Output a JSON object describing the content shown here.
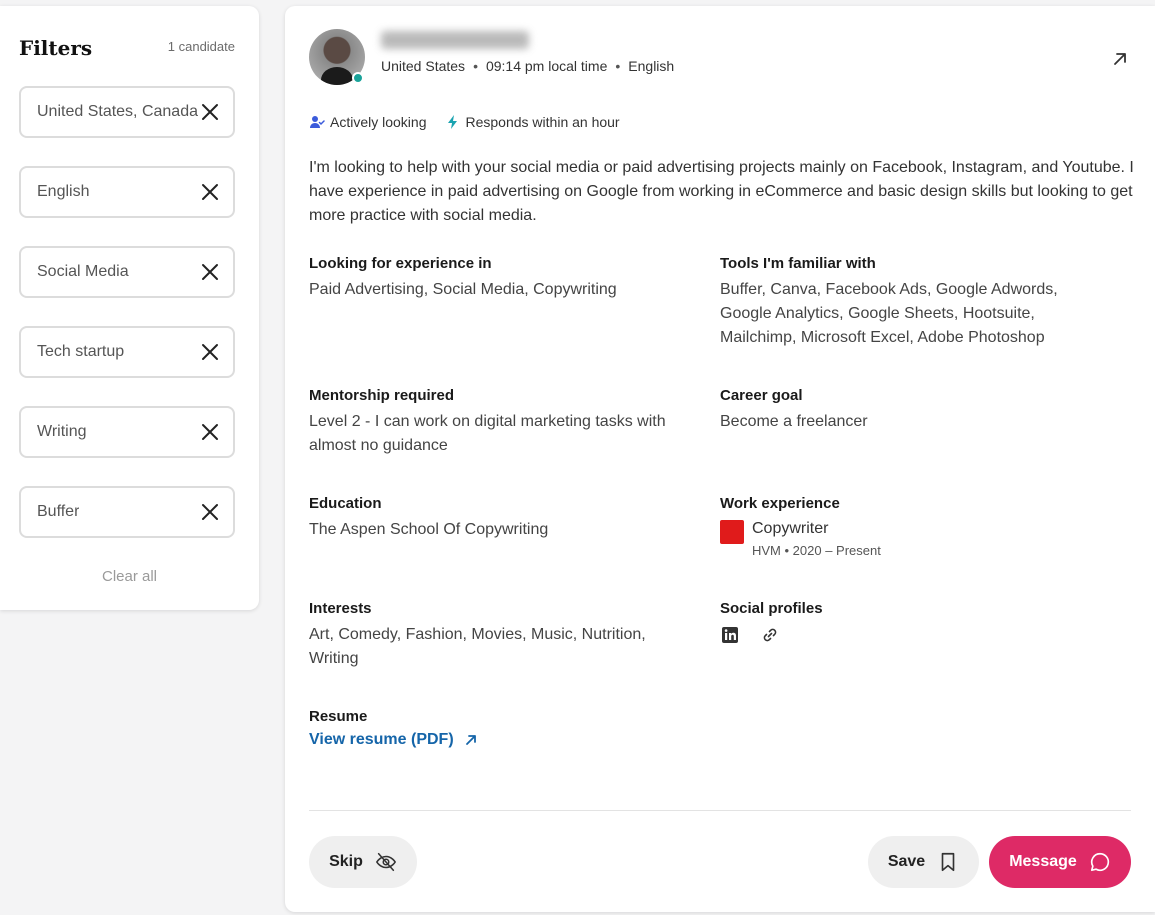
{
  "filters": {
    "title": "Filters",
    "count": "1 candidate",
    "chips": [
      "United States, Canada",
      "English",
      "Social Media",
      "Tech startup",
      "Writing",
      "Buffer"
    ],
    "clear_all": "Clear all"
  },
  "profile": {
    "meta": {
      "country": "United States",
      "time": "09:14 pm local time",
      "language": "English",
      "separator": "•"
    },
    "badges": {
      "status": "Actively looking",
      "response": "Responds within an hour"
    },
    "bio": "I'm looking to help with your social media or paid advertising projects mainly on Facebook, Instagram, and Youtube. I have experience in paid advertising on Google from working in eCommerce and basic design skills but looking to get more practice with social media.",
    "fields": {
      "looking_title": "Looking for experience in",
      "looking_value": "Paid Advertising, Social Media, Copywriting",
      "tools_title": "Tools I'm familiar with",
      "tools_value": "Buffer, Canva, Facebook Ads, Google Adwords, Google Analytics, Google Sheets, Hootsuite, Mailchimp, Microsoft Excel, Adobe Photoshop",
      "mentorship_title": "Mentorship required",
      "mentorship_value": "Level 2 - I can work on digital marketing tasks with almost no guidance",
      "goal_title": "Career goal",
      "goal_value": "Become a freelancer",
      "education_title": "Education",
      "education_value": "The Aspen School Of Copywriting",
      "work_title": "Work experience",
      "work_role": "Copywriter",
      "work_detail": "HVM  •  2020 – Present",
      "interests_title": "Interests",
      "interests_value": "Art, Comedy, Fashion, Movies, Music, Nutrition, Writing",
      "social_title": "Social profiles",
      "resume_title": "Resume",
      "resume_link": "View resume (PDF)"
    }
  },
  "actions": {
    "skip": "Skip",
    "save": "Save",
    "message": "Message"
  },
  "colors": {
    "accent": "#de2a66",
    "link": "#1565a9",
    "online": "#1aa39a",
    "work_logo": "#e01b1b"
  },
  "icons": [
    "close-icon",
    "external-link-icon",
    "user-check-icon",
    "lightning-icon",
    "linkedin-icon",
    "link-icon",
    "eye-off-icon",
    "bookmark-icon",
    "chat-bubble-icon"
  ]
}
